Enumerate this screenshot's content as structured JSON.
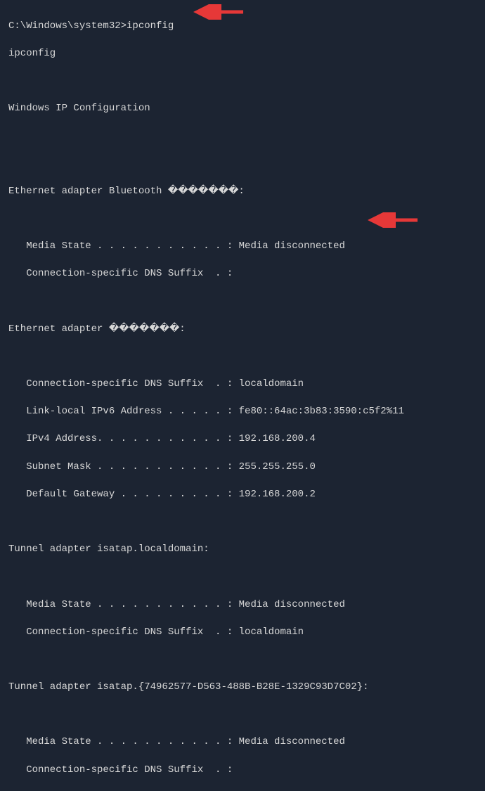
{
  "prompt": "C:\\Windows\\system32>ipconfig",
  "echo": "ipconfig",
  "header": "Windows IP Configuration",
  "adapters": [
    {
      "title": "Ethernet adapter Bluetooth �������:",
      "lines": [
        "   Media State . . . . . . . . . . . : Media disconnected",
        "   Connection-specific DNS Suffix  . :"
      ]
    },
    {
      "title": "Ethernet adapter �������:",
      "lines": [
        "   Connection-specific DNS Suffix  . : localdomain",
        "   Link-local IPv6 Address . . . . . : fe80::64ac:3b83:3590:c5f2%11",
        "   IPv4 Address. . . . . . . . . . . : 192.168.200.4",
        "   Subnet Mask . . . . . . . . . . . : 255.255.255.0",
        "   Default Gateway . . . . . . . . . : 192.168.200.2"
      ]
    },
    {
      "title": "Tunnel adapter isatap.localdomain:",
      "lines": [
        "   Media State . . . . . . . . . . . : Media disconnected",
        "   Connection-specific DNS Suffix  . : localdomain"
      ]
    },
    {
      "title": "Tunnel adapter isatap.{74962577-D563-488B-B28E-1329C93D7C02}:",
      "lines": [
        "   Media State . . . . . . . . . . . : Media disconnected",
        "   Connection-specific DNS Suffix  . :"
      ]
    }
  ],
  "annotations": {
    "arrow1_target": "ipconfig command",
    "arrow2_target": "IPv4 Address 192.168.200.4"
  }
}
